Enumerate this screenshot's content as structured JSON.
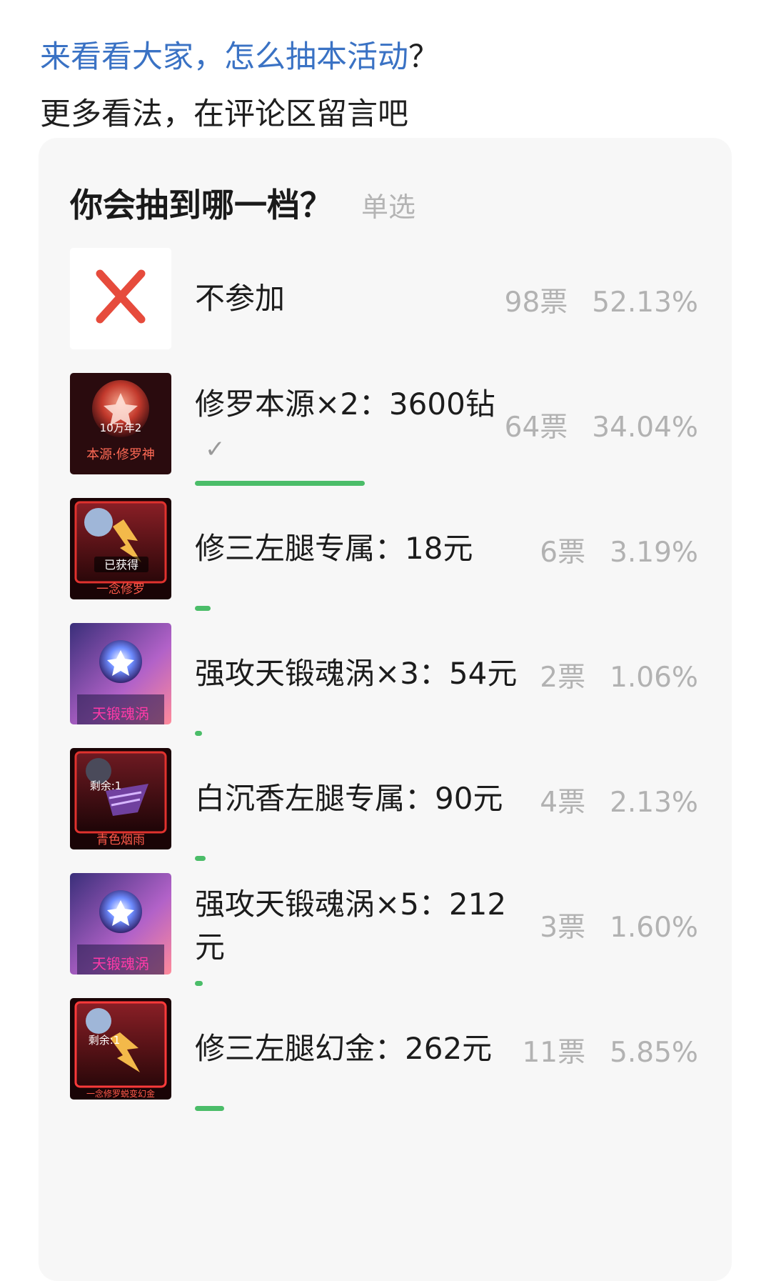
{
  "intro": {
    "link_text": "来看看大家，怎么抽本活动",
    "link_suffix": "？",
    "subtitle": "更多看法，在评论区留言吧"
  },
  "poll": {
    "title": "你会抽到哪一档？",
    "type": "单选",
    "accent": "#4bbd69",
    "options": [
      {
        "label": "不参加",
        "votes": "98票",
        "percent": "52.13%",
        "share": 0.5213,
        "selected": false,
        "icon": "red-cross-icon",
        "thumb_text": ""
      },
      {
        "label": "修罗本源×2：3600钻",
        "votes": "64票",
        "percent": "34.04%",
        "share": 0.3404,
        "selected": true,
        "icon": "shura-origin-orb-icon",
        "thumb_text": "本源·修罗神",
        "thumb_sub": "10万年2"
      },
      {
        "label": "修三左腿专属：18元",
        "votes": "6票",
        "percent": "3.19%",
        "share": 0.0319,
        "selected": false,
        "icon": "shura-soul-bone-card",
        "thumb_text": "一念修罗",
        "thumb_sub": "已获得"
      },
      {
        "label": "强攻天锻魂涡×3：54元",
        "votes": "2票",
        "percent": "1.06%",
        "share": 0.0106,
        "selected": false,
        "icon": "tianduan-vortex-card",
        "thumb_text": "天锻魂涡"
      },
      {
        "label": "白沉香左腿专属：90元",
        "votes": "4票",
        "percent": "2.13%",
        "share": 0.0213,
        "selected": false,
        "icon": "baichenxiang-soul-bone-card",
        "thumb_text": "青色烟雨",
        "thumb_sub": "剩余:1"
      },
      {
        "label": "强攻天锻魂涡×5：212元",
        "votes": "3票",
        "percent": "1.60%",
        "share": 0.016,
        "selected": false,
        "icon": "tianduan-vortex-card",
        "thumb_text": "天锻魂涡"
      },
      {
        "label": "修三左腿幻金：262元",
        "votes": "11票",
        "percent": "5.85%",
        "share": 0.0585,
        "selected": false,
        "icon": "shura-gold-soul-bone-card",
        "thumb_text": "一念修罗蜕变幻金",
        "thumb_sub": "剩余:1"
      }
    ]
  }
}
